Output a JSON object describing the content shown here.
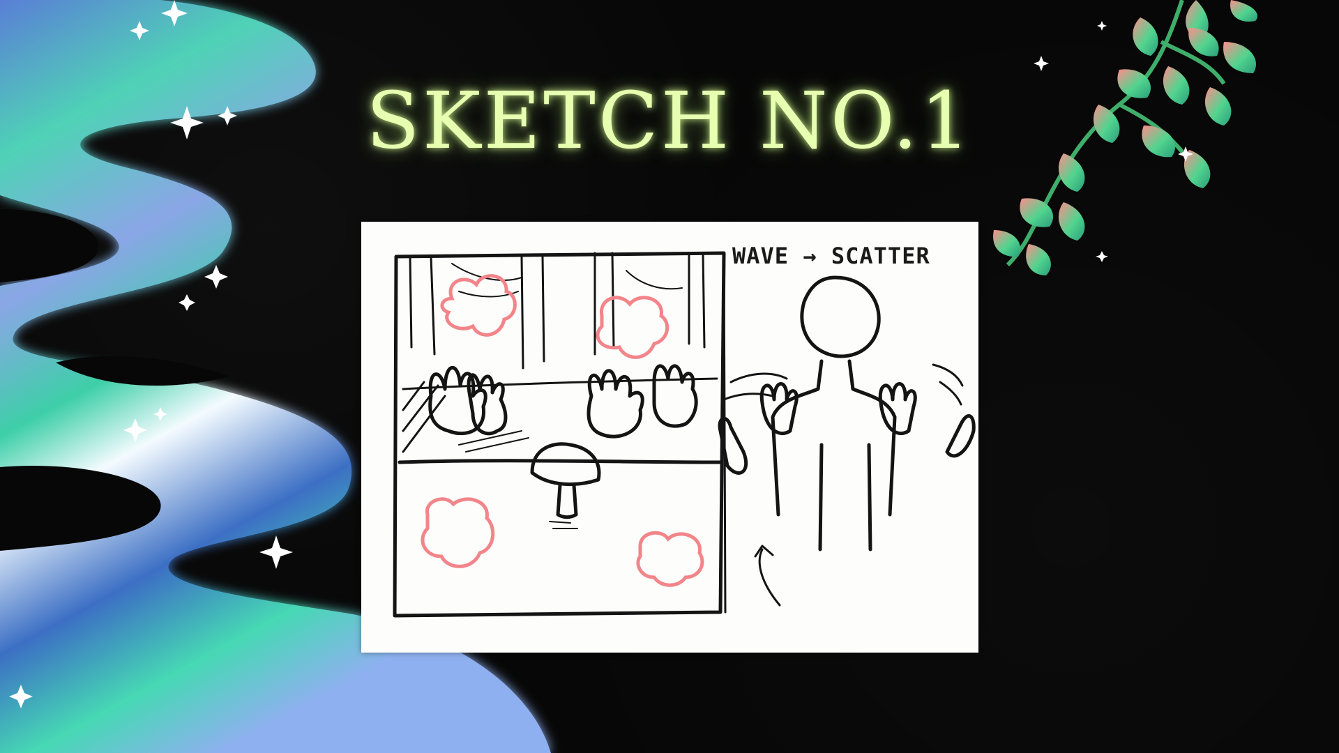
{
  "title": "SKETCH NO.1",
  "sketch": {
    "note": "WAVE → SCATTER"
  },
  "colors": {
    "background": "#070707",
    "title": "#e7ffb1",
    "highlight": "#f2858a",
    "wave_teal": "#3fd6b0",
    "wave_blue": "#5b86d8",
    "leaf_green": "#5fdc8c",
    "leaf_pink": "#ff8f8f"
  },
  "icons": [
    "sparkle-icon",
    "leaf-icon",
    "arrow-icon"
  ]
}
